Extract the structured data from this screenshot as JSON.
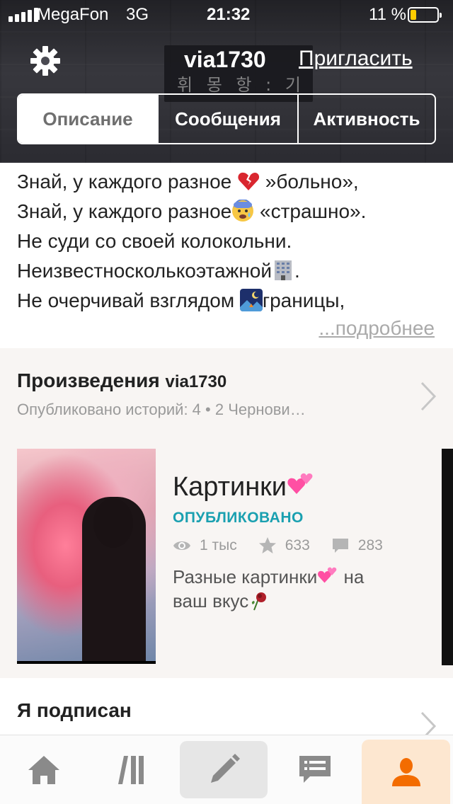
{
  "status_bar": {
    "carrier": "MegaFon",
    "network": "3G",
    "time": "21:32",
    "battery_percent": "11 %",
    "battery_level": 0.11,
    "battery_color": "#ffcc00"
  },
  "header": {
    "settings_icon": "gear-icon",
    "username": "via1730",
    "invite_label": "Пригласить",
    "tabs": [
      {
        "label": "Описание",
        "active": true
      },
      {
        "label": "Сообщения",
        "active": false
      },
      {
        "label": "Активность",
        "active": false
      }
    ]
  },
  "bio": {
    "lines": [
      "Знай, у каждого разное",
      "»больно»,",
      "Знай, у каждого разное",
      "«страшно».",
      "Не суди со своей колокольни.",
      "Неизвестносколькоэтажной",
      ".",
      "Не очерчивай взглядом",
      "границы,"
    ],
    "more_label": "...подробнее"
  },
  "works": {
    "title_prefix": "Произведения",
    "username": "via1730",
    "subtitle": "Опубликовано историй: 4 • 2 Чернови…",
    "story": {
      "title": "Картинки",
      "status": "ОПУБЛИКОВАНО",
      "views": "1 тыс",
      "votes": "633",
      "comments": "283",
      "description_line1": "Разные картинки",
      "description_line1_end": " на",
      "description_line2": "ваш вкус"
    }
  },
  "following": {
    "title": "Я подписан"
  },
  "tabbar": {
    "items": [
      {
        "icon": "home-icon"
      },
      {
        "icon": "library-icon"
      },
      {
        "icon": "pencil-icon"
      },
      {
        "icon": "messages-icon"
      },
      {
        "icon": "profile-icon"
      }
    ],
    "accent": "#f36c00"
  }
}
